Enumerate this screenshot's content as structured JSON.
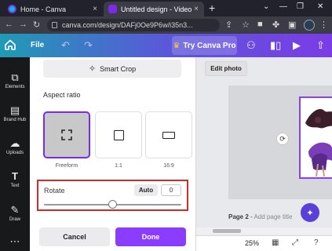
{
  "browser": {
    "tabs": [
      {
        "title": "Home - Canva"
      },
      {
        "title": "Untitled design - Video"
      }
    ],
    "new_tab": "+",
    "close_glyph": "×",
    "window_controls": [
      "⌄",
      "—",
      "❐",
      "✕"
    ],
    "url": "canva.com/design/DAFj0Oe9P6w/i35n3..."
  },
  "toolbar": {
    "file_label": "File",
    "try_pro_label": "Try Canva Pro"
  },
  "rail": {
    "items": [
      {
        "label": "Elements"
      },
      {
        "label": "Brand Hub"
      },
      {
        "label": "Uploads"
      },
      {
        "label": "Text"
      },
      {
        "label": "Draw"
      }
    ]
  },
  "panel": {
    "smart_crop_label": "Smart Crop",
    "aspect_ratio_title": "Aspect ratio",
    "ratios": [
      {
        "label": "Freeform",
        "selected": true
      },
      {
        "label": "1:1",
        "selected": false
      },
      {
        "label": "16:9",
        "selected": false
      }
    ],
    "rotate_label": "Rotate",
    "auto_label": "Auto",
    "rotate_value": "0",
    "rotate_slider_fraction": 0.5,
    "cancel_label": "Cancel",
    "done_label": "Done"
  },
  "canvas": {
    "edit_photo_label": "Edit photo",
    "page_label": "Page 2",
    "page_sep": " - ",
    "add_title_placeholder": "Add page title",
    "zoom_level": "25%"
  },
  "colors": {
    "accent": "#8b3dff",
    "highlight_box": "#d62a2a",
    "rail_bg": "#18191b"
  }
}
